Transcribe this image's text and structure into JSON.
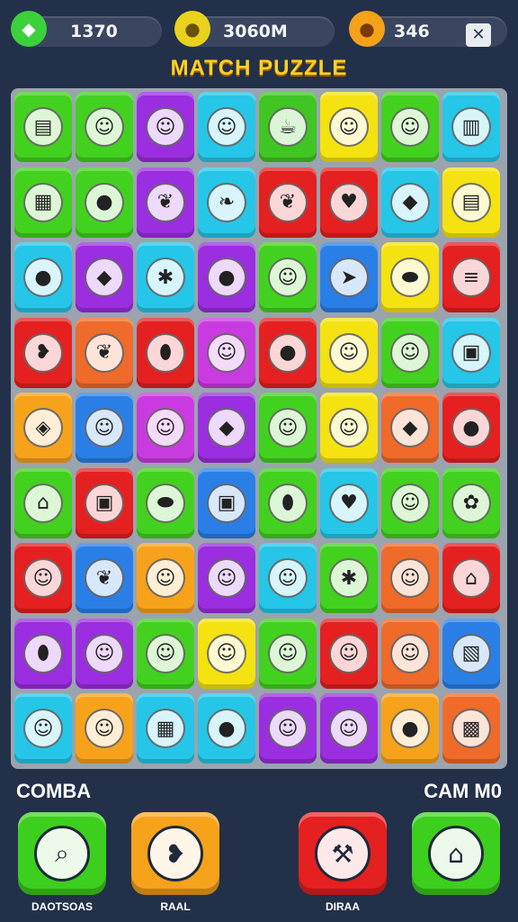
{
  "hud": {
    "score": "1370",
    "distance": "3060M",
    "coins": "346",
    "close_label": "✕",
    "icons": [
      "gem-icon",
      "coin-icon",
      "fruit-icon"
    ],
    "icon_colors": [
      "#3bd13b",
      "#e8d21c",
      "#f5a21a"
    ]
  },
  "title": "MATCH PUZZLE",
  "board": {
    "rows": 9,
    "cols": 8,
    "tiles": [
      [
        "#43d11f",
        "#43d11f",
        "#9b2ee0",
        "#26c6e8",
        "#3fc622",
        "#f4e310",
        "#43d11f",
        "#26c6e8"
      ],
      [
        "#43d11f",
        "#43d11f",
        "#9b2ee0",
        "#26c6e8",
        "#e52020",
        "#e52020",
        "#26c6e8",
        "#f4e310"
      ],
      [
        "#26c6e8",
        "#9b2ee0",
        "#26c6e8",
        "#9b2ee0",
        "#43d11f",
        "#2a7fe6",
        "#f4e310",
        "#e52020"
      ],
      [
        "#e52020",
        "#f06a2a",
        "#e52020",
        "#c93be0",
        "#e52020",
        "#f4e310",
        "#43d11f",
        "#26c6e8"
      ],
      [
        "#f7a21b",
        "#2a7fe6",
        "#c93be0",
        "#9b2ee0",
        "#43d11f",
        "#f4e310",
        "#f06a2a",
        "#e52020"
      ],
      [
        "#43d11f",
        "#e52020",
        "#43d11f",
        "#2a7fe6",
        "#43d11f",
        "#26c6e8",
        "#43d11f",
        "#43d11f"
      ],
      [
        "#e52020",
        "#2a7fe6",
        "#f7a21b",
        "#9b2ee0",
        "#26c6e8",
        "#43d11f",
        "#f06a2a",
        "#e52020"
      ],
      [
        "#9b2ee0",
        "#9b2ee0",
        "#43d11f",
        "#f4e310",
        "#43d11f",
        "#e52020",
        "#f06a2a",
        "#2a7fe6"
      ],
      [
        "#26c6e8",
        "#f7a21b",
        "#26c6e8",
        "#26c6e8",
        "#9b2ee0",
        "#9b2ee0",
        "#f7a21b",
        "#f06a2a"
      ]
    ],
    "symbols": [
      [
        "book-icon",
        "face-icon",
        "face-icon",
        "face-icon",
        "teapot-icon",
        "face-icon",
        "face-icon",
        "cup-icon"
      ],
      [
        "scroll-icon",
        "apple-icon",
        "leaf-icon",
        "pepper-icon",
        "leaf-icon",
        "strawberry-icon",
        "gem-icon",
        "note-icon"
      ],
      [
        "plum-icon",
        "gem-icon",
        "star-icon",
        "apple-icon",
        "face-icon",
        "arrow-icon",
        "bean-icon",
        "burger-icon"
      ],
      [
        "eggplant-icon",
        "leaf-icon",
        "egg-icon",
        "face-icon",
        "apple-icon",
        "face-icon",
        "face-icon",
        "jar-icon"
      ],
      [
        "cube-icon",
        "face-icon",
        "face-icon",
        "gem-icon",
        "face-icon",
        "face-icon",
        "gem-icon",
        "apple-icon"
      ],
      [
        "house-icon",
        "jar-icon",
        "bean-icon",
        "lock-icon",
        "egg-icon",
        "strawberry-icon",
        "face-icon",
        "flower-icon"
      ],
      [
        "face-icon",
        "leaf-icon",
        "face-icon",
        "face-icon",
        "face-icon",
        "star-icon",
        "face-icon",
        "house-icon"
      ],
      [
        "egg-icon",
        "face-icon",
        "face-icon",
        "face-icon",
        "face-icon",
        "face-icon",
        "face-icon",
        "box-icon"
      ],
      [
        "face-icon",
        "face-icon",
        "scroll-icon",
        "apple-icon",
        "face-icon",
        "face-icon",
        "plum-icon",
        "basket-icon"
      ]
    ],
    "glyphs": {
      "book-icon": "▤",
      "face-icon": "☺",
      "cup-icon": "▥",
      "teapot-icon": "☕",
      "scroll-icon": "▦",
      "apple-icon": "●",
      "leaf-icon": "❦",
      "pepper-icon": "❧",
      "strawberry-icon": "♥",
      "gem-icon": "◆",
      "note-icon": "▤",
      "plum-icon": "●",
      "star-icon": "✱",
      "arrow-icon": "➤",
      "bean-icon": "⬬",
      "burger-icon": "≡",
      "eggplant-icon": "❥",
      "egg-icon": "⬮",
      "jar-icon": "▣",
      "cube-icon": "◈",
      "house-icon": "⌂",
      "lock-icon": "▣",
      "flower-icon": "✿",
      "box-icon": "▧",
      "basket-icon": "▩"
    }
  },
  "sections": {
    "left": "COMBA",
    "right": "CAM M0"
  },
  "buttons": [
    {
      "label": "DAOTSOAS",
      "color": "#3ccf1e",
      "icon": "search-icon",
      "glyph": "⌕"
    },
    {
      "label": "RAAL",
      "color": "#f7a21b",
      "icon": "eggplant-icon",
      "glyph": "❥"
    },
    {
      "label": "DIRAA",
      "color": "#e52020",
      "icon": "hammer-icon",
      "glyph": "⚒"
    },
    {
      "label": "",
      "color": "#3ccf1e",
      "icon": "home-icon",
      "glyph": "⌂"
    }
  ]
}
